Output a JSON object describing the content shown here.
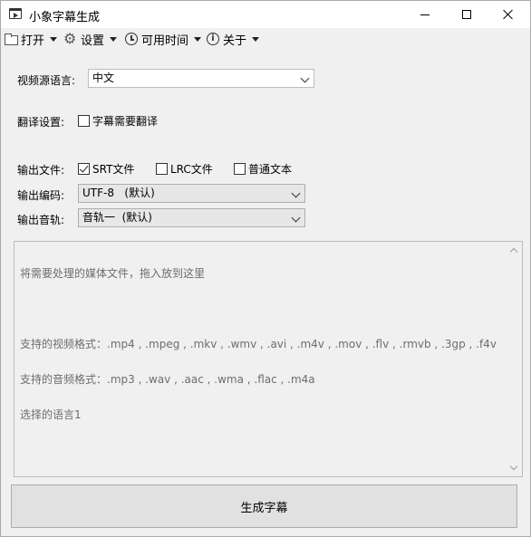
{
  "window": {
    "title": "小象字幕生成",
    "controls": {
      "minimize": "minimize",
      "maximize": "maximize",
      "close": "close"
    }
  },
  "menubar": {
    "items": [
      {
        "label": "打开",
        "icon": "folder-icon"
      },
      {
        "label": "设置",
        "icon": "gear-icon"
      },
      {
        "label": "可用时间",
        "icon": "clock-icon"
      },
      {
        "label": "关于",
        "icon": "info-icon"
      }
    ]
  },
  "form": {
    "source_language": {
      "label": "视频源语言:",
      "value": "中文"
    },
    "translation": {
      "label": "翻译设置:",
      "checkbox_label": "字幕需要翻译",
      "checked": false
    },
    "output_file": {
      "label": "输出文件:",
      "options": [
        {
          "label": "SRT文件",
          "checked": true
        },
        {
          "label": "LRC文件",
          "checked": false
        },
        {
          "label": "普通文本",
          "checked": false
        }
      ]
    },
    "encoding": {
      "label": "输出编码:",
      "value": "UTF-8   (默认)"
    },
    "audio_track": {
      "label": "输出音轨:",
      "value": "音轨一  (默认)"
    }
  },
  "drop_area": {
    "lines": [
      "将需要处理的媒体文件，拖入放到这里",
      "",
      "支持的视频格式：.mp4 , .mpeg , .mkv , .wmv , .avi , .m4v , .mov , .flv , .rmvb , .3gp , .f4v",
      "支持的音频格式：.mp3 , .wav , .aac , .wma , .flac , .m4a",
      "选择的语言1"
    ]
  },
  "generate_button": {
    "label": "生成字幕"
  }
}
